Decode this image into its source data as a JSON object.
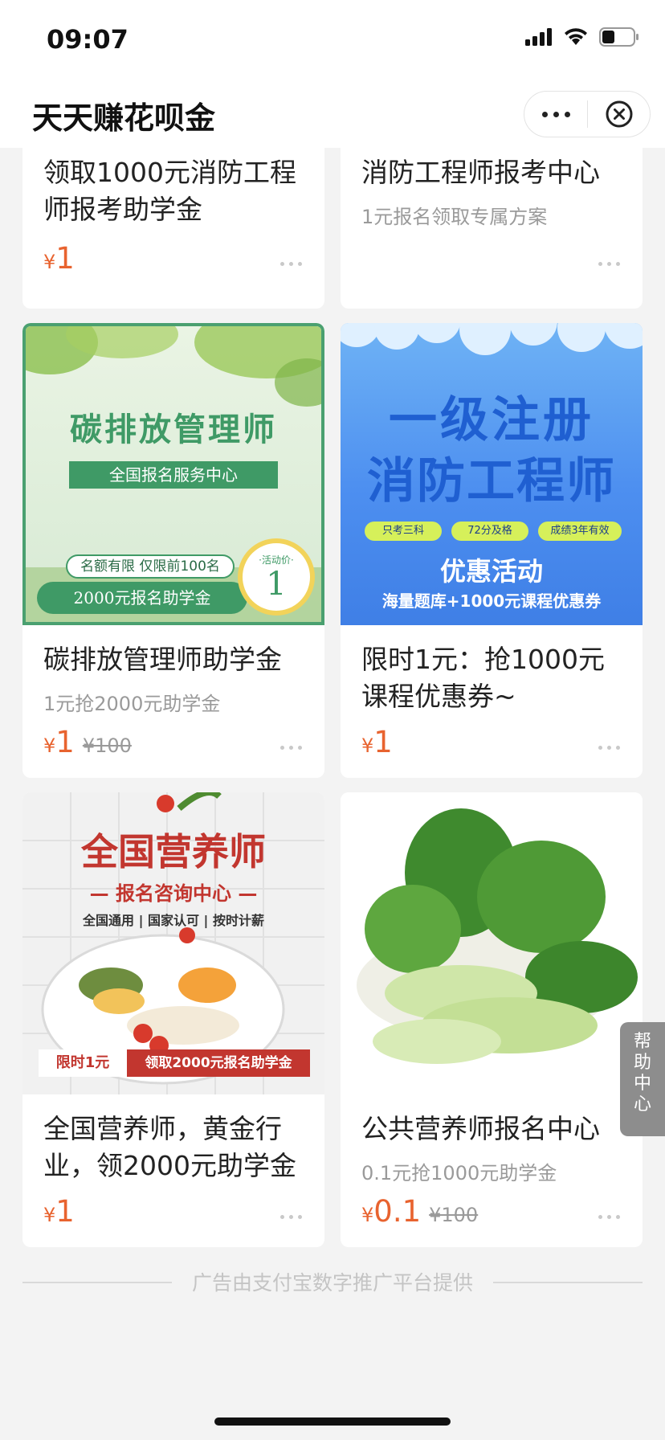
{
  "status_bar": {
    "time": "09:07"
  },
  "nav": {
    "title": "天天赚花呗金"
  },
  "products": [
    {
      "title": "领取1000元消防工程师报考助学金",
      "subtitle": "",
      "currency": "¥",
      "price": "1",
      "original_price": ""
    },
    {
      "title": "消防工程师报考中心",
      "subtitle": "1元报名领取专属方案",
      "currency": "¥",
      "price": "",
      "original_price": ""
    },
    {
      "title": "碳排放管理师助学金",
      "subtitle": "1元抢2000元助学金",
      "currency": "¥",
      "price": "1",
      "original_price": "¥100",
      "image_text": {
        "heading": "碳排放管理师",
        "banner": "全国报名服务中心",
        "line1": "名额有限 仅限前100名",
        "line2": "2000元报名助学金",
        "badge_label": "·活动价·",
        "badge_price": "1"
      }
    },
    {
      "title": "限时1元：抢1000元课程优惠券~",
      "subtitle": "",
      "currency": "¥",
      "price": "1",
      "original_price": "",
      "image_text": {
        "line1": "一级注册",
        "line2": "消防工程师",
        "pill1": "只考三科",
        "pill2": "72分及格",
        "pill3": "成绩3年有效",
        "promo": "优惠活动",
        "promo_sub": "海量题库+1000元课程优惠券"
      }
    },
    {
      "title": "全国营养师，黄金行业，领2000元助学金",
      "subtitle": "",
      "currency": "¥",
      "price": "1",
      "original_price": "",
      "image_text": {
        "heading": "全国营养师",
        "sub": "— 报名咨询中心 —",
        "tags": "全国通用 | 国家认可 | 按时计薪",
        "tag_left": "限时1元",
        "tag_right": "领取2000元报名助学金"
      }
    },
    {
      "title": "公共营养师报名中心",
      "subtitle": "0.1元抢1000元助学金",
      "currency": "¥",
      "price": "0.1",
      "original_price": "¥100"
    }
  ],
  "footer": {
    "text": "广告由支付宝数字推广平台提供"
  },
  "help_tab": {
    "label": "帮助中心"
  },
  "colors": {
    "price": "#e8632f",
    "background": "#f3f3f3",
    "accent_green": "#3f9a66",
    "accent_blue": "#4d8ff0"
  }
}
